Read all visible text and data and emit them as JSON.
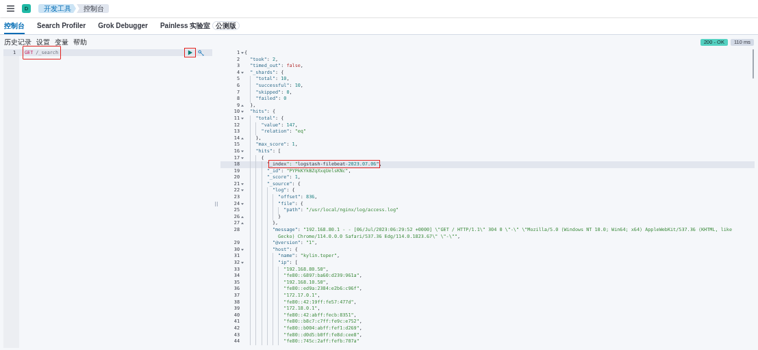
{
  "header": {
    "avatar": "D",
    "breadcrumbs": [
      {
        "label": "开发工具",
        "current": false
      },
      {
        "label": "控制台",
        "current": true
      }
    ]
  },
  "tabs": [
    {
      "label": "控制台",
      "selected": true
    },
    {
      "label": "Search Profiler",
      "selected": false
    },
    {
      "label": "Grok Debugger",
      "selected": false
    },
    {
      "label": "Painless 实验室",
      "badge": "公测版",
      "selected": false
    }
  ],
  "toolbar": {
    "links": [
      "历史记录",
      "设置",
      "变量",
      "帮助"
    ],
    "status": "200 - OK",
    "time": "110 ms"
  },
  "request_editor": {
    "run_boxed": true,
    "lines": [
      {
        "no": "1",
        "method": "GET",
        "path": "/_search",
        "active": true,
        "boxed": true
      }
    ]
  },
  "response": {
    "lines": [
      {
        "no": "1",
        "fold_start": true,
        "text": "{",
        "active": false
      },
      {
        "no": "2",
        "text": "  \"took\": 2,",
        "active": false
      },
      {
        "no": "3",
        "text": "  \"timed_out\": false,",
        "active": false
      },
      {
        "no": "4",
        "fold_start": true,
        "text": "  \"_shards\": {",
        "active": false
      },
      {
        "no": "5",
        "text": "    \"total\": 10,",
        "active": false
      },
      {
        "no": "6",
        "text": "    \"successful\": 10,",
        "active": false
      },
      {
        "no": "7",
        "text": "    \"skipped\": 0,",
        "active": false
      },
      {
        "no": "8",
        "text": "    \"failed\": 0",
        "active": false
      },
      {
        "no": "9",
        "fold_end": true,
        "text": "  },",
        "active": false
      },
      {
        "no": "10",
        "fold_start": true,
        "text": "  \"hits\": {",
        "active": false
      },
      {
        "no": "11",
        "fold_start": true,
        "text": "    \"total\": {",
        "active": false
      },
      {
        "no": "12",
        "text": "      \"value\": 147,",
        "active": false
      },
      {
        "no": "13",
        "text": "      \"relation\": \"eq\"",
        "active": false
      },
      {
        "no": "14",
        "fold_end": true,
        "text": "    },",
        "active": false
      },
      {
        "no": "15",
        "text": "    \"max_score\": 1,",
        "active": false
      },
      {
        "no": "16",
        "fold_start": true,
        "text": "    \"hits\": [",
        "active": false
      },
      {
        "no": "17",
        "fold_start": true,
        "text": "      {",
        "active": false
      },
      {
        "no": "18",
        "text": "        \"",
        "boxed": "_index\": \"logstash-filebeat-2023.07.06\"",
        "after": ",",
        "active": true
      },
      {
        "no": "19",
        "text": "        \"_id\": \"PYPkKYkBZqXxqUelsKNc\",",
        "active": false
      },
      {
        "no": "20",
        "text": "        \"_score\": 1,",
        "active": false
      },
      {
        "no": "21",
        "fold_start": true,
        "text": "        \"_source\": {",
        "active": false
      },
      {
        "no": "22",
        "fold_start": true,
        "text": "          \"log\": {",
        "active": false
      },
      {
        "no": "23",
        "text": "            \"offset\": 836,",
        "active": false
      },
      {
        "no": "24",
        "fold_start": true,
        "text": "            \"file\": {",
        "active": false
      },
      {
        "no": "25",
        "text": "              \"path\": \"/usr/local/nginx/log/access.log\"",
        "active": false
      },
      {
        "no": "26",
        "fold_end": true,
        "text": "            }",
        "active": false
      },
      {
        "no": "27",
        "fold_end": true,
        "text": "          },",
        "active": false
      },
      {
        "no": "28",
        "text": "          \"message\": \"192.168.80.1 - - [06/Jul/2023:06:29:52 +0000] \\\"GET / HTTP/1.1\\\" 304 0 \\\"-\\\" \\\"Mozilla/5.0 (Windows NT 10.0; Win64; x64) AppleWebKit/537.36 (KHTML, like Gecko) Chrome/114.0.0.0 Safari/537.36 Edg/114.0.1823.67\\\" \\\"-\\\"\",",
        "active": false
      },
      {
        "no": "29",
        "text": "          \"@version\": \"1\",",
        "active": false
      },
      {
        "no": "30",
        "fold_start": true,
        "text": "          \"host\": {",
        "active": false
      },
      {
        "no": "31",
        "text": "            \"name\": \"kylin.toper\",",
        "active": false
      },
      {
        "no": "32",
        "fold_start": true,
        "text": "            \"ip\": [",
        "active": false
      },
      {
        "no": "33",
        "text": "              \"192.168.80.50\",",
        "active": false
      },
      {
        "no": "34",
        "text": "              \"fe80::6897:ba60:d239:961a\",",
        "active": false
      },
      {
        "no": "35",
        "text": "              \"192.168.10.50\",",
        "active": false
      },
      {
        "no": "36",
        "text": "              \"fe80::ed9a:2384:e2b6:c96f\",",
        "active": false
      },
      {
        "no": "37",
        "text": "              \"172.17.0.1\",",
        "active": false
      },
      {
        "no": "38",
        "text": "              \"fe80::42:19ff:fe57:477d\",",
        "active": false
      },
      {
        "no": "39",
        "text": "              \"172.18.0.1\",",
        "active": false
      },
      {
        "no": "40",
        "text": "              \"fe80::42:abff:fecb:8351\",",
        "active": false
      },
      {
        "no": "41",
        "text": "              \"fe80::b8c7:c7ff:fe9c:e752\",",
        "active": false
      },
      {
        "no": "42",
        "text": "              \"fe80::b004:abff:fef1:d269\",",
        "active": false
      },
      {
        "no": "43",
        "text": "              \"fe80::d0d5:b0ff:fe8d:cee8\",",
        "active": false
      },
      {
        "no": "44",
        "text": "              \"fe80::745c:2aff:fefb:707a\"",
        "active": false
      }
    ]
  }
}
